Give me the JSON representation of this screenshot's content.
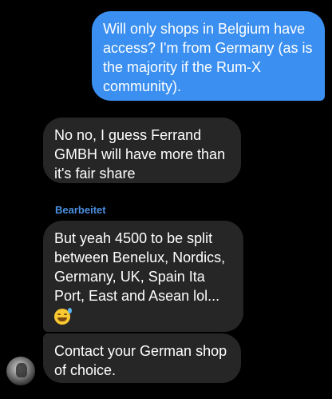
{
  "messages": {
    "outgoing_1": "Will only shops in Belgium have access? I'm from Germany (as is the majority if the Rum-X community).",
    "incoming_1": "No no, I guess Ferrand GMBH will have more than it's fair share",
    "edited_label": "Bearbeitet",
    "incoming_2": "But yeah 4500 to be split between Benelux, Nordics, Germany, UK, Spain Ita Port, East and Asean lol...",
    "incoming_2_emoji": "grinning-face-with-sweat-icon",
    "incoming_3": "Contact your German shop of choice."
  },
  "colors": {
    "background": "#000000",
    "outgoing_bubble": "#3a8ff0",
    "incoming_bubble": "#262626",
    "edited_label": "#4a8fe0",
    "text": "#ffffff"
  },
  "avatar_icon": "user-avatar-icon"
}
